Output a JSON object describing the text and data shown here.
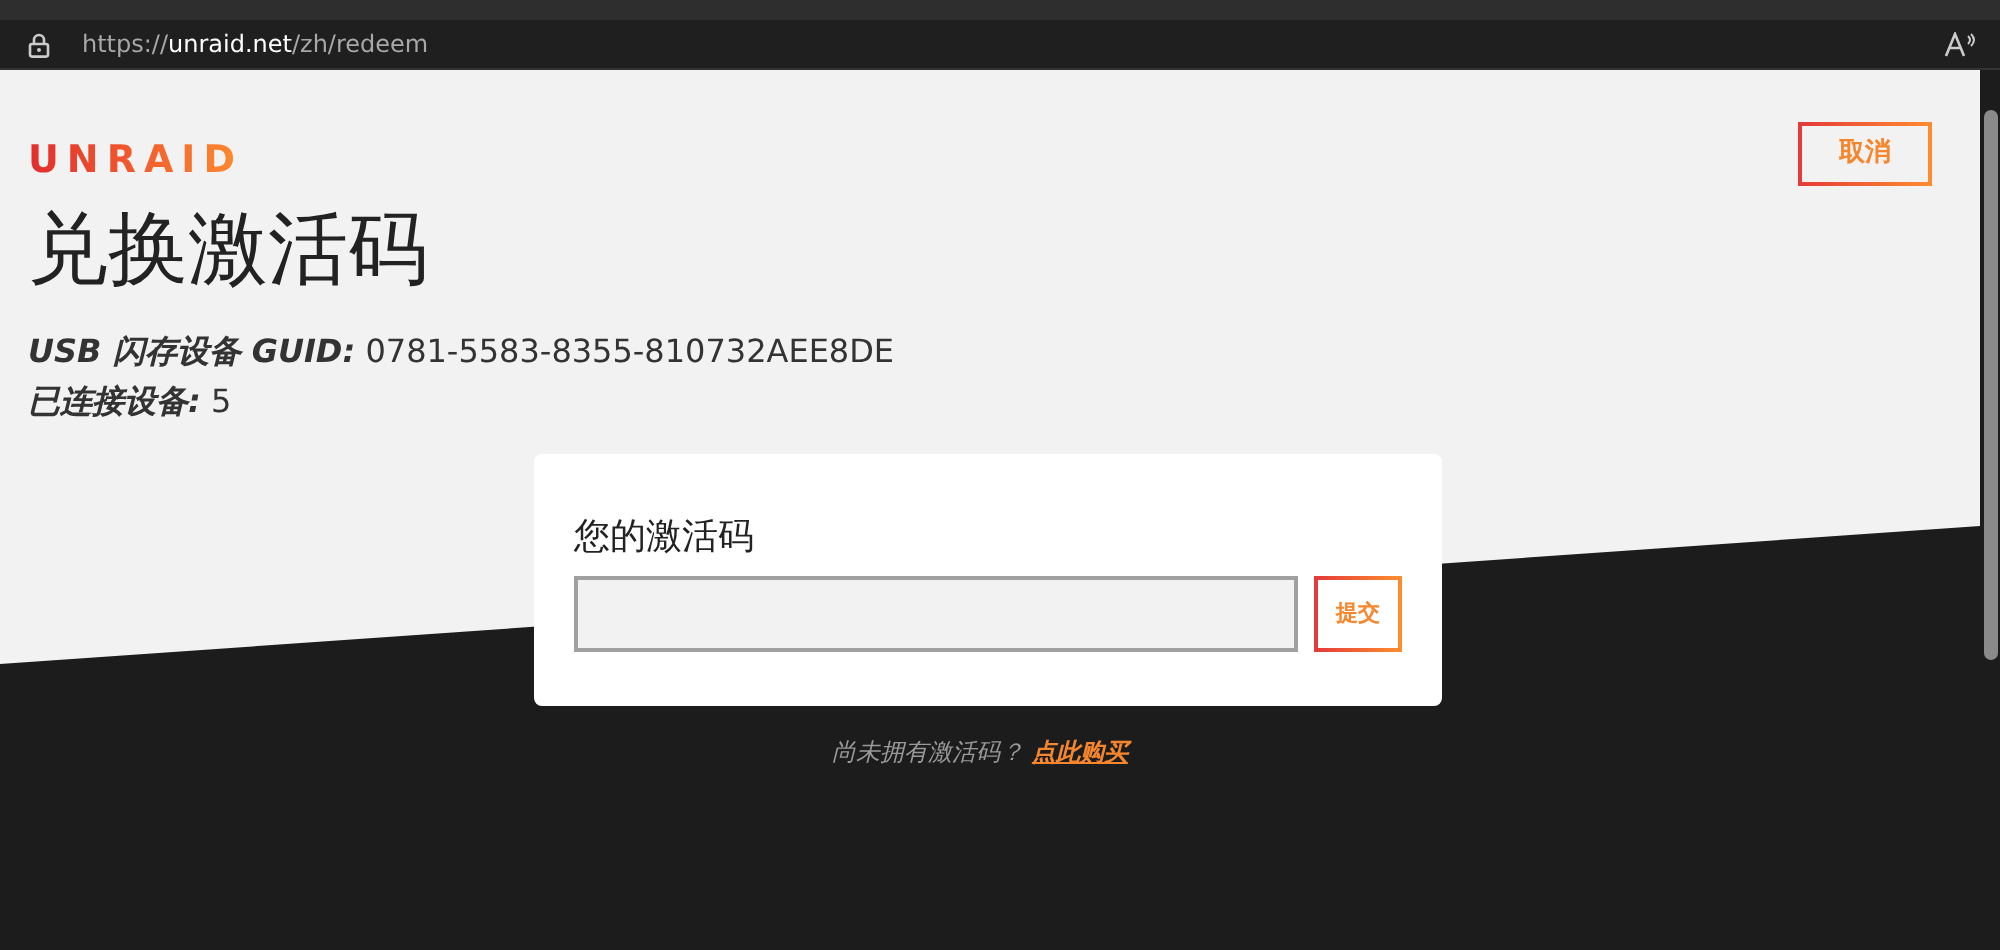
{
  "browser": {
    "url": "https://**unraid.net**/zh/redeem"
  },
  "header": {
    "logo": "UNRAID",
    "cancel_button": "取消"
  },
  "title": "兑换激活码",
  "info": [
    {
      "label": "USB 闪存设备 GUID:",
      "value": "0781-5583-8355-810732AEE8DE"
    },
    {
      "label": "已连接设备:",
      "value": "5"
    }
  ],
  "form": {
    "label": "您的激活码",
    "submit_button": "提交"
  },
  "footer": {
    "text": "尚未拥有激活码？",
    "link": "点此购买"
  }
}
